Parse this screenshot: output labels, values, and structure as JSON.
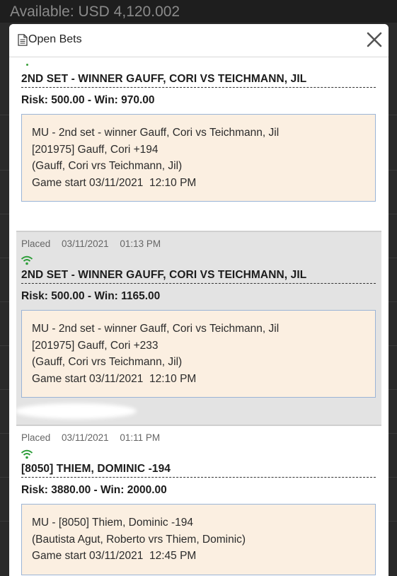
{
  "background": {
    "available_text": "Available: USD 4,120.002"
  },
  "modal": {
    "title": "Open Bets",
    "doc_icon": "document-icon",
    "close_icon": "close-icon"
  },
  "bets": [
    {
      "placed_label": "",
      "date": "",
      "time": "",
      "title": "2ND SET - WINNER GAUFF, CORI VS TEICHMANN, JIL",
      "risk_win": "Risk: 500.00 - Win: 970.00",
      "details": [
        "MU - 2nd set - winner Gauff, Cori vs Teichmann, Jil",
        "[201975] Gauff, Cori +194",
        "(Gauff, Cori vrs Teichmann, Jil)",
        "Game start 03/11/2021  12:10 PM"
      ]
    },
    {
      "placed_label": "Placed",
      "date": "03/11/2021",
      "time": "01:13 PM",
      "title": "2ND SET - WINNER GAUFF, CORI VS TEICHMANN, JIL",
      "risk_win": "Risk: 500.00 - Win: 1165.00",
      "details": [
        "MU - 2nd set - winner Gauff, Cori vs Teichmann, Jil",
        "[201975] Gauff, Cori +233",
        "(Gauff, Cori vrs Teichmann, Jil)",
        "Game start 03/11/2021  12:10 PM"
      ]
    },
    {
      "placed_label": "Placed",
      "date": "03/11/2021",
      "time": "01:11 PM",
      "title": "[8050] THIEM, DOMINIC -194",
      "risk_win": "Risk: 3880.00 - Win: 2000.00",
      "details": [
        "MU - [8050] Thiem, Dominic -194",
        "(Bautista Agut, Roberto vrs Thiem, Dominic)",
        "Game start 03/11/2021  12:45 PM"
      ]
    }
  ],
  "colors": {
    "accent_green": "#2e9e3a",
    "detail_bg": "#fbefe1",
    "detail_border": "#9bb4d6"
  }
}
